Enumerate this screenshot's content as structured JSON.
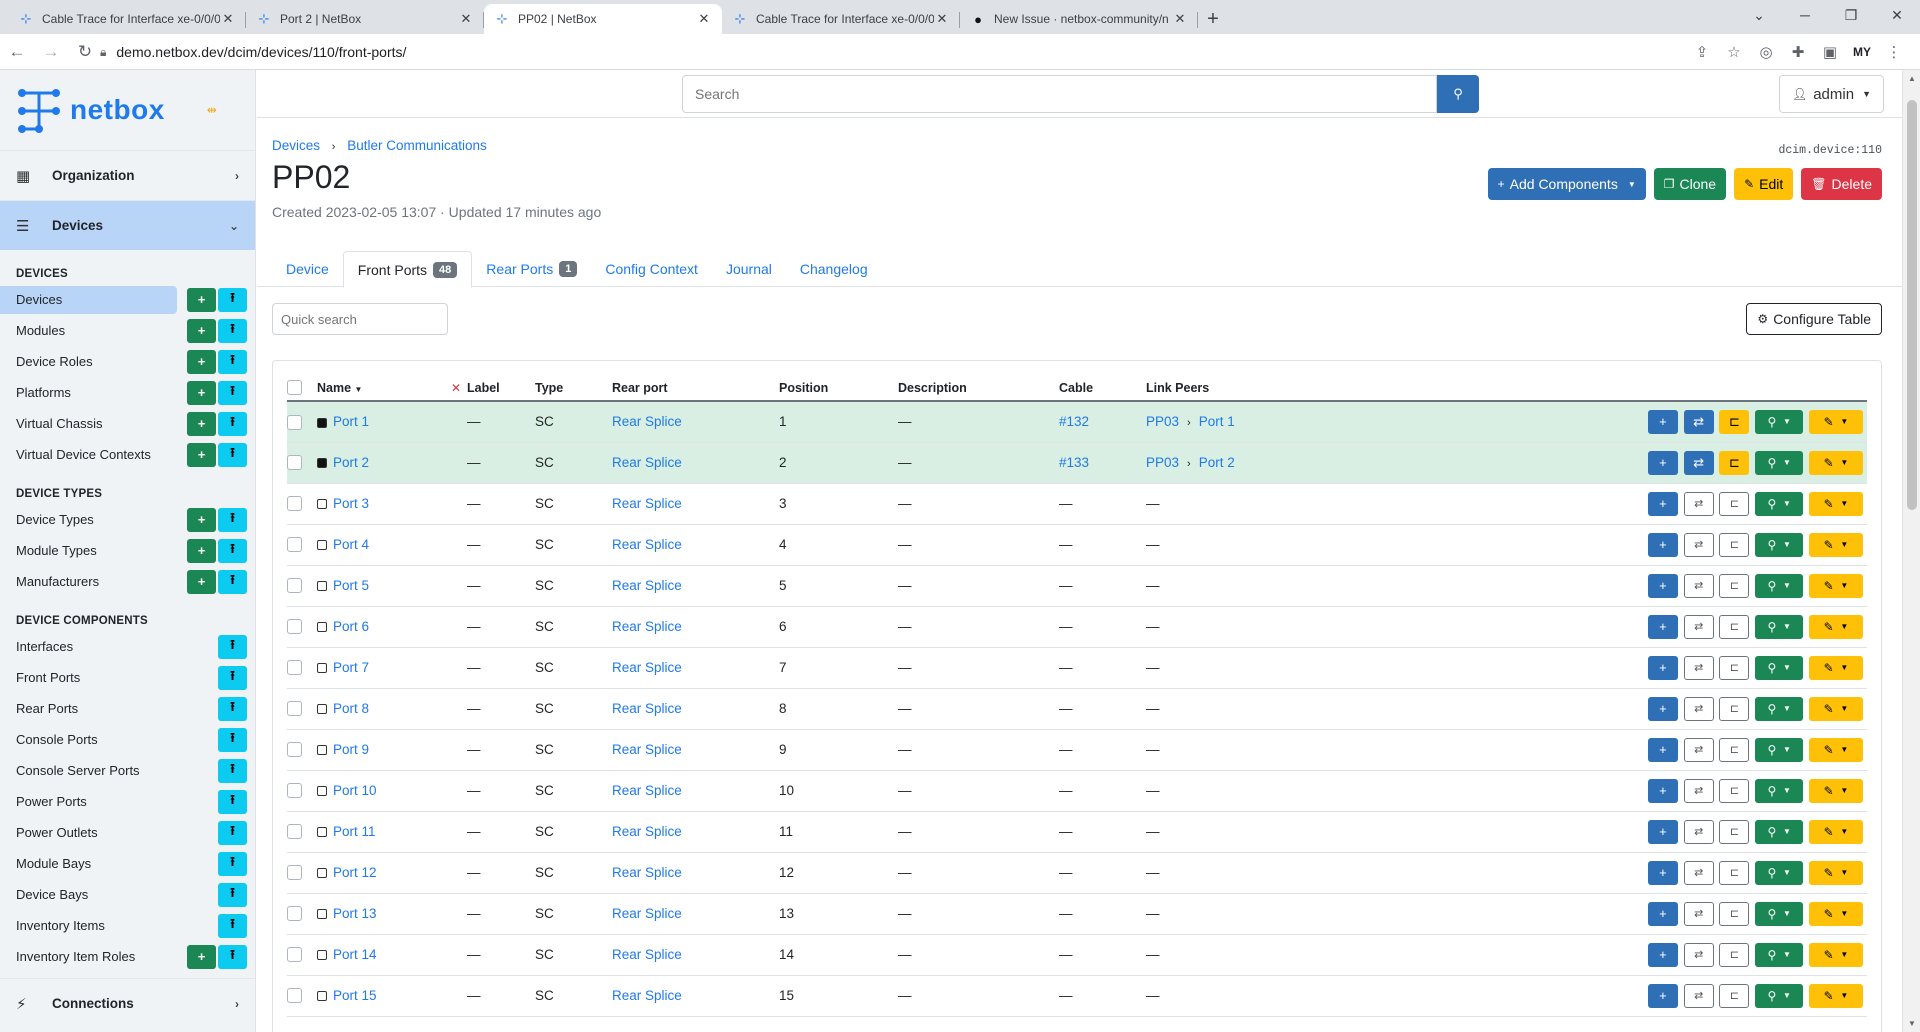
{
  "browser": {
    "tabs": [
      {
        "title": "Cable Trace for Interface xe-0/0/0",
        "icon": "netbox-icon",
        "active": false
      },
      {
        "title": "Port 2 | NetBox",
        "icon": "netbox-icon",
        "active": false
      },
      {
        "title": "PP02 | NetBox",
        "icon": "netbox-icon",
        "active": true
      },
      {
        "title": "Cable Trace for Interface xe-0/0/0",
        "icon": "netbox-icon",
        "active": false
      },
      {
        "title": "New Issue · netbox-community/n",
        "icon": "github-icon",
        "active": false
      }
    ],
    "url": "demo.netbox.dev/dcim/devices/110/front-ports/",
    "profile": "MY"
  },
  "brand": {
    "name": "netbox"
  },
  "sidebar": {
    "organization": "Organization",
    "devices_group": "Devices",
    "connections": "Connections",
    "sections": [
      {
        "title": "DEVICES",
        "items": [
          {
            "label": "Devices",
            "add": true,
            "import": true,
            "active": true
          },
          {
            "label": "Modules",
            "add": true,
            "import": true
          },
          {
            "label": "Device Roles",
            "add": true,
            "import": true
          },
          {
            "label": "Platforms",
            "add": true,
            "import": true
          },
          {
            "label": "Virtual Chassis",
            "add": true,
            "import": true
          },
          {
            "label": "Virtual Device Contexts",
            "add": true,
            "import": true
          }
        ]
      },
      {
        "title": "DEVICE TYPES",
        "items": [
          {
            "label": "Device Types",
            "add": true,
            "import": true
          },
          {
            "label": "Module Types",
            "add": true,
            "import": true
          },
          {
            "label": "Manufacturers",
            "add": true,
            "import": true
          }
        ]
      },
      {
        "title": "DEVICE COMPONENTS",
        "items": [
          {
            "label": "Interfaces",
            "add": false,
            "import": true
          },
          {
            "label": "Front Ports",
            "add": false,
            "import": true
          },
          {
            "label": "Rear Ports",
            "add": false,
            "import": true
          },
          {
            "label": "Console Ports",
            "add": false,
            "import": true
          },
          {
            "label": "Console Server Ports",
            "add": false,
            "import": true
          },
          {
            "label": "Power Ports",
            "add": false,
            "import": true
          },
          {
            "label": "Power Outlets",
            "add": false,
            "import": true
          },
          {
            "label": "Module Bays",
            "add": false,
            "import": true
          },
          {
            "label": "Device Bays",
            "add": false,
            "import": true
          },
          {
            "label": "Inventory Items",
            "add": false,
            "import": true
          },
          {
            "label": "Inventory Item Roles",
            "add": true,
            "import": true
          }
        ]
      }
    ]
  },
  "topnav": {
    "search_placeholder": "Search",
    "user": "admin"
  },
  "header": {
    "breadcrumbs": [
      "Devices",
      "Butler Communications"
    ],
    "title": "PP02",
    "meta": "Created 2023-02-05 13:07 · Updated 17 minutes ago",
    "object_id": "dcim.device:110",
    "actions": {
      "add_components": "Add Components",
      "clone": "Clone",
      "edit": "Edit",
      "delete": "Delete"
    }
  },
  "tabs": [
    {
      "label": "Device",
      "badge": null,
      "active": false
    },
    {
      "label": "Front Ports",
      "badge": "48",
      "active": true
    },
    {
      "label": "Rear Ports",
      "badge": "1",
      "active": false
    },
    {
      "label": "Config Context",
      "badge": null,
      "active": false
    },
    {
      "label": "Journal",
      "badge": null,
      "active": false
    },
    {
      "label": "Changelog",
      "badge": null,
      "active": false
    }
  ],
  "toolbar": {
    "quick_search_placeholder": "Quick search",
    "configure_table": "Configure Table"
  },
  "table": {
    "columns": [
      "Name",
      "Label",
      "Type",
      "Rear port",
      "Position",
      "Description",
      "Cable",
      "Link Peers"
    ],
    "rows": [
      {
        "name": "Port 1",
        "label": "—",
        "type": "SC",
        "rear_port": "Rear Splice",
        "position": "1",
        "description": "—",
        "cable": "#132",
        "peer_device": "PP03",
        "peer_port": "Port 1",
        "connected": true
      },
      {
        "name": "Port 2",
        "label": "—",
        "type": "SC",
        "rear_port": "Rear Splice",
        "position": "2",
        "description": "—",
        "cable": "#133",
        "peer_device": "PP03",
        "peer_port": "Port 2",
        "connected": true
      },
      {
        "name": "Port 3",
        "label": "—",
        "type": "SC",
        "rear_port": "Rear Splice",
        "position": "3",
        "description": "—",
        "cable": "—",
        "peer_device": "—",
        "peer_port": "",
        "connected": false
      },
      {
        "name": "Port 4",
        "label": "—",
        "type": "SC",
        "rear_port": "Rear Splice",
        "position": "4",
        "description": "—",
        "cable": "—",
        "peer_device": "—",
        "peer_port": "",
        "connected": false
      },
      {
        "name": "Port 5",
        "label": "—",
        "type": "SC",
        "rear_port": "Rear Splice",
        "position": "5",
        "description": "—",
        "cable": "—",
        "peer_device": "—",
        "peer_port": "",
        "connected": false
      },
      {
        "name": "Port 6",
        "label": "—",
        "type": "SC",
        "rear_port": "Rear Splice",
        "position": "6",
        "description": "—",
        "cable": "—",
        "peer_device": "—",
        "peer_port": "",
        "connected": false
      },
      {
        "name": "Port 7",
        "label": "—",
        "type": "SC",
        "rear_port": "Rear Splice",
        "position": "7",
        "description": "—",
        "cable": "—",
        "peer_device": "—",
        "peer_port": "",
        "connected": false
      },
      {
        "name": "Port 8",
        "label": "—",
        "type": "SC",
        "rear_port": "Rear Splice",
        "position": "8",
        "description": "—",
        "cable": "—",
        "peer_device": "—",
        "peer_port": "",
        "connected": false
      },
      {
        "name": "Port 9",
        "label": "—",
        "type": "SC",
        "rear_port": "Rear Splice",
        "position": "9",
        "description": "—",
        "cable": "—",
        "peer_device": "—",
        "peer_port": "",
        "connected": false
      },
      {
        "name": "Port 10",
        "label": "—",
        "type": "SC",
        "rear_port": "Rear Splice",
        "position": "10",
        "description": "—",
        "cable": "—",
        "peer_device": "—",
        "peer_port": "",
        "connected": false
      },
      {
        "name": "Port 11",
        "label": "—",
        "type": "SC",
        "rear_port": "Rear Splice",
        "position": "11",
        "description": "—",
        "cable": "—",
        "peer_device": "—",
        "peer_port": "",
        "connected": false
      },
      {
        "name": "Port 12",
        "label": "—",
        "type": "SC",
        "rear_port": "Rear Splice",
        "position": "12",
        "description": "—",
        "cable": "—",
        "peer_device": "—",
        "peer_port": "",
        "connected": false
      },
      {
        "name": "Port 13",
        "label": "—",
        "type": "SC",
        "rear_port": "Rear Splice",
        "position": "13",
        "description": "—",
        "cable": "—",
        "peer_device": "—",
        "peer_port": "",
        "connected": false
      },
      {
        "name": "Port 14",
        "label": "—",
        "type": "SC",
        "rear_port": "Rear Splice",
        "position": "14",
        "description": "—",
        "cable": "—",
        "peer_device": "—",
        "peer_port": "",
        "connected": false
      },
      {
        "name": "Port 15",
        "label": "—",
        "type": "SC",
        "rear_port": "Rear Splice",
        "position": "15",
        "description": "—",
        "cable": "—",
        "peer_device": "—",
        "peer_port": "",
        "connected": false
      }
    ]
  }
}
